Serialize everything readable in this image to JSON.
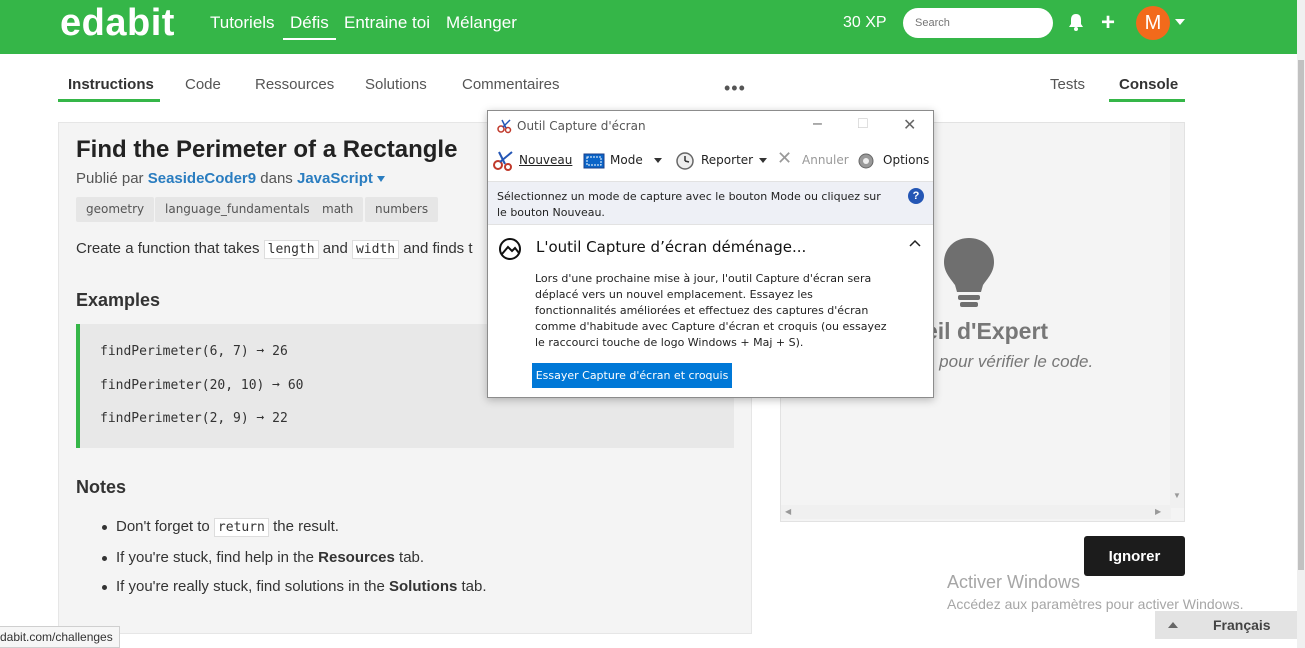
{
  "nav": {
    "logo": "edabit",
    "links": [
      "Tutoriels",
      "Défis",
      "Entraine toi",
      "Mélanger"
    ],
    "xp": "30 XP",
    "search_placeholder": "Search",
    "avatar_letter": "M",
    "brand_color": "#35b648",
    "avatar_color": "#f26a1b"
  },
  "tabs": {
    "left": [
      "Instructions",
      "Code",
      "Ressources",
      "Solutions",
      "Commentaires"
    ],
    "more": "•••",
    "right": [
      "Tests",
      "Console"
    ]
  },
  "challenge": {
    "title": "Find the Perimeter of a Rectangle",
    "published_prefix": "Publié par",
    "author": "SeasideCoder9",
    "in_word": "dans",
    "language": "JavaScript",
    "tags": [
      "geometry",
      "language_fundamentals",
      "math",
      "numbers"
    ],
    "desc_prefix": "Create a function that takes",
    "desc_code1": "length",
    "desc_and": "and",
    "desc_code2": "width",
    "desc_suffix": "and finds t",
    "examples_heading": "Examples",
    "examples": [
      "findPerimeter(6, 7) ➞ 26",
      "findPerimeter(20, 10) ➞ 60",
      "findPerimeter(2, 9) ➞ 22"
    ],
    "notes_heading": "Notes",
    "note1_prefix": "Don't forget to",
    "note1_code": "return",
    "note1_suffix": "the result.",
    "note2_prefix": "If you're stuck, find help in the",
    "note2_bold": "Resources",
    "note2_suffix": "tab.",
    "note3_prefix": "If you're really stuck, find solutions in the",
    "note3_bold": "Solutions",
    "note3_suffix": "tab."
  },
  "expert": {
    "title": "eil d'Expert",
    "subtitle": "e pour vérifier le code."
  },
  "ignore_button": "Ignorer",
  "windows_activation": {
    "title": "Activer Windows",
    "subtitle": "Accédez aux paramètres pour activer Windows."
  },
  "language_selector": "Français",
  "status_url": "dabit.com/challenges",
  "snipping_tool": {
    "window_title": "Outil Capture d'écran",
    "toolbar": {
      "new": "Nouveau",
      "mode": "Mode",
      "delay": "Reporter",
      "cancel": "Annuler",
      "options": "Options"
    },
    "info": "Sélectionnez un mode de capture avec le bouton Mode ou cliquez sur le bouton Nouveau.",
    "moving_title": "L'outil Capture d’écran déménage...",
    "moving_body": "Lors d'une prochaine mise à jour, l'outil Capture d'écran sera déplacé vers un nouvel emplacement. Essayez les fonctionnalités améliorées et effectuez des captures d'écran comme d'habitude avec Capture d'écran et croquis (ou essayez le raccourci touche de logo Windows + Maj + S).",
    "try_button": "Essayer Capture d'écran et croquis"
  }
}
